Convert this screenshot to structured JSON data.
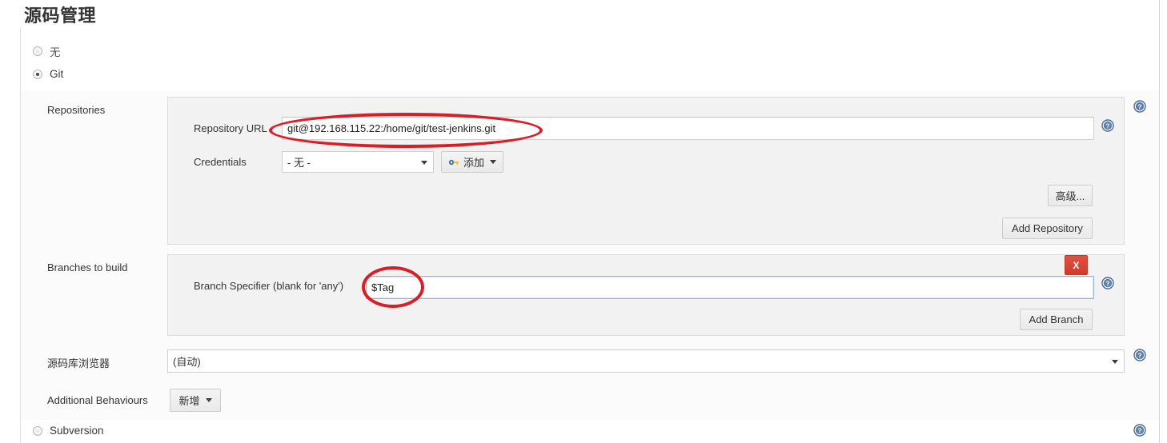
{
  "page": {
    "title": "源码管理"
  },
  "scm_options": [
    {
      "label": "无",
      "selected": false
    },
    {
      "label": "Git",
      "selected": true
    },
    {
      "label": "Subversion",
      "selected": false
    }
  ],
  "rows": {
    "repositories_label": "Repositories",
    "branches_label": "Branches to build",
    "repository_browser_label": "源码库浏览器",
    "additional_behaviours_label": "Additional Behaviours"
  },
  "repositories": {
    "url_label": "Repository URL",
    "url_value": "git@192.168.115.22:/home/git/test-jenkins.git",
    "url_placeholder": "",
    "credentials_label": "Credentials",
    "credentials_value": "- 无 -",
    "credentials_add_label": "添加",
    "advanced_label": "高级...",
    "add_repository_label": "Add Repository"
  },
  "branches": {
    "specifier_label": "Branch Specifier (blank for 'any')",
    "specifier_value": "$Tag",
    "specifier_placeholder": "",
    "add_branch_label": "Add Branch",
    "delete_label": "X"
  },
  "repository_browser": {
    "value": "(自动)"
  },
  "additional_behaviours": {
    "add_label": "新增"
  },
  "icons": {
    "help": "help-icon",
    "caret_down": "chevron-down-icon",
    "key": "key-icon"
  },
  "colors": {
    "accent_help": "#4a6a9a",
    "danger": "#d03a29",
    "annotation": "#d81f28",
    "panel_bg": "#f2f2f2",
    "band_bg": "#fbfbfb",
    "focus_border": "#9ab2dd"
  }
}
